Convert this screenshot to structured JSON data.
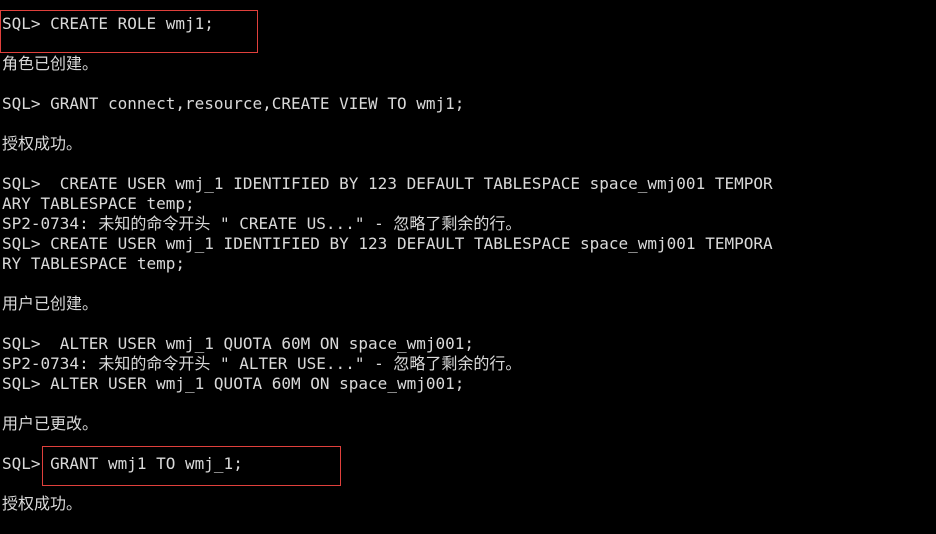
{
  "theme": {
    "background": "#000000",
    "text_color": "#d9d9d9",
    "highlight_border": "#e0403c"
  },
  "lines": [
    "SQL> CREATE ROLE wmj1;",
    "角色已创建。",
    "SQL> GRANT connect,resource,CREATE VIEW TO wmj1;",
    "授权成功。",
    "SQL>  CREATE USER wmj_1 IDENTIFIED BY 123 DEFAULT TABLESPACE space_wmj001 TEMPOR",
    "ARY TABLESPACE temp;",
    "SP2-0734: 未知的命令开头 \" CREATE US...\" - 忽略了剩余的行。",
    "SQL> CREATE USER wmj_1 IDENTIFIED BY 123 DEFAULT TABLESPACE space_wmj001 TEMPORA",
    "RY TABLESPACE temp;",
    "用户已创建。",
    "SQL>  ALTER USER wmj_1 QUOTA 60M ON space_wmj001;",
    "SP2-0734: 未知的命令开头 \" ALTER USE...\" - 忽略了剩余的行。",
    "SQL> ALTER USER wmj_1 QUOTA 60M ON space_wmj001;",
    "用户已更改。",
    "SQL> GRANT wmj1 TO wmj_1;",
    "授权成功。"
  ]
}
